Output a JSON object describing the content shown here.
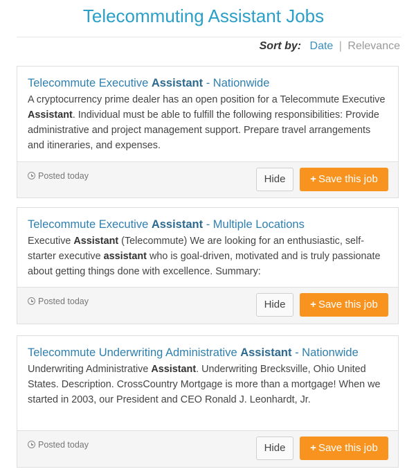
{
  "page": {
    "title": "Telecommuting Assistant Jobs"
  },
  "sort": {
    "label": "Sort by:",
    "date": "Date",
    "separator": "|",
    "relevance": "Relevance"
  },
  "colors": {
    "title": "#2b9fc7",
    "link": "#2f7fae",
    "save_button": "#f7931e"
  },
  "jobs": [
    {
      "title_pre": "Telecommute Executive ",
      "title_kw": "Assistant",
      "title_post": " - Nationwide",
      "desc_1": "A cryptocurrency prime dealer has an open position for a Telecommute Executive ",
      "desc_kw1": "Assistant",
      "desc_2": ". Individual must be able to fulfill the following responsibilities: Provide administrative and project management support. Prepare travel arrangements and itineraries, and expenses.",
      "desc_kw2": "",
      "desc_3": "",
      "posted": "Posted today",
      "hide_label": "Hide",
      "save_label": "Save this job"
    },
    {
      "title_pre": "Telecommute Executive ",
      "title_kw": "Assistant",
      "title_post": " - Multiple Locations",
      "desc_1": "Executive ",
      "desc_kw1": "Assistant",
      "desc_2": " (Telecommute) We are looking for an enthusiastic, self-starter executive ",
      "desc_kw2": "assistant",
      "desc_3": " who is goal-driven, motivated and is truly passionate about getting things done with excellence. Summary:",
      "posted": "Posted today",
      "hide_label": "Hide",
      "save_label": "Save this job"
    },
    {
      "title_pre": "Telecommute Underwriting Administrative ",
      "title_kw": "Assistant",
      "title_post": " - Nationwide",
      "desc_1": "Underwriting Administrative ",
      "desc_kw1": "Assistant",
      "desc_2": ". Underwriting Brecksville, Ohio United States. Description. CrossCountry Mortgage is more than a mortgage! When we started in 2003, our President and CEO Ronald J. Leonhardt, Jr.",
      "desc_kw2": "",
      "desc_3": "",
      "posted": "Posted today",
      "hide_label": "Hide",
      "save_label": "Save this job"
    }
  ]
}
